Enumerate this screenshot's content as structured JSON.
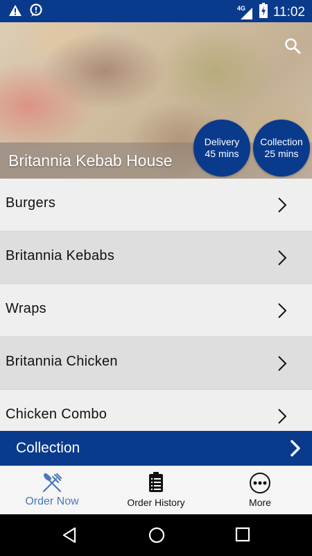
{
  "status_bar": {
    "time": "11:02",
    "network": "4G",
    "icons": [
      "warning-icon",
      "notification-icon",
      "signal-icon",
      "battery-icon"
    ]
  },
  "hero": {
    "restaurant_name": "Britannia Kebab House",
    "delivery": {
      "label": "Delivery",
      "time": "45 mins"
    },
    "collection": {
      "label": "Collection",
      "time": "25 mins"
    }
  },
  "menu": {
    "items": [
      {
        "label": "Burgers"
      },
      {
        "label": "Britannia Kebabs"
      },
      {
        "label": "Wraps"
      },
      {
        "label": "Britannia Chicken"
      },
      {
        "label": "Chicken Combo"
      }
    ]
  },
  "order_mode_bar": {
    "label": "Collection"
  },
  "bottom_nav": {
    "items": [
      {
        "label": "Order Now",
        "icon": "fork-knife-icon",
        "active": true
      },
      {
        "label": "Order History",
        "icon": "clipboard-icon",
        "active": false
      },
      {
        "label": "More",
        "icon": "more-icon",
        "active": false
      }
    ]
  },
  "colors": {
    "brand": "#0a3a8c",
    "active_nav": "#4b78b5",
    "row_light": "#efefef",
    "row_dark": "#dedede"
  }
}
